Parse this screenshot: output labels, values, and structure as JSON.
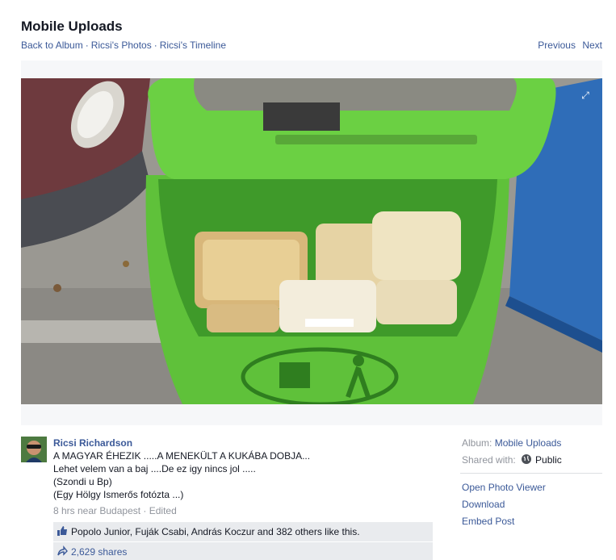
{
  "header": {
    "album_title": "Mobile Uploads",
    "breadcrumb": [
      "Back to Album",
      "Ricsi's Photos",
      "Ricsi's Timeline"
    ],
    "separator": "·",
    "previous": "Previous",
    "next": "Next"
  },
  "post": {
    "author": "Ricsi Richardson",
    "lines": [
      "A MAGYAR ÉHEZIK .....A MENEKÜLT A KUKÁBA DOBJA...",
      "Lehet velem van a baj ....De ez igy nincs jol .....",
      "(Szondi u Bp)",
      "(Egy Hölgy Ismerős fotózta ...)"
    ],
    "time": "8 hrs near Budapest",
    "edited": "Edited",
    "likes": "Popolo Junior, Fuják Csabi, András Koczur and 382 others like this.",
    "shares": "2,629 shares"
  },
  "info": {
    "album_label": "Album:",
    "album_value": "Mobile Uploads",
    "shared_label": "Shared with:",
    "shared_value": "Public",
    "actions": [
      "Open Photo Viewer",
      "Download",
      "Embed Post"
    ]
  },
  "colors": {
    "link": "#3b5998",
    "bin_green": "#5fc13a",
    "bin_dark": "#2f7e1f"
  }
}
